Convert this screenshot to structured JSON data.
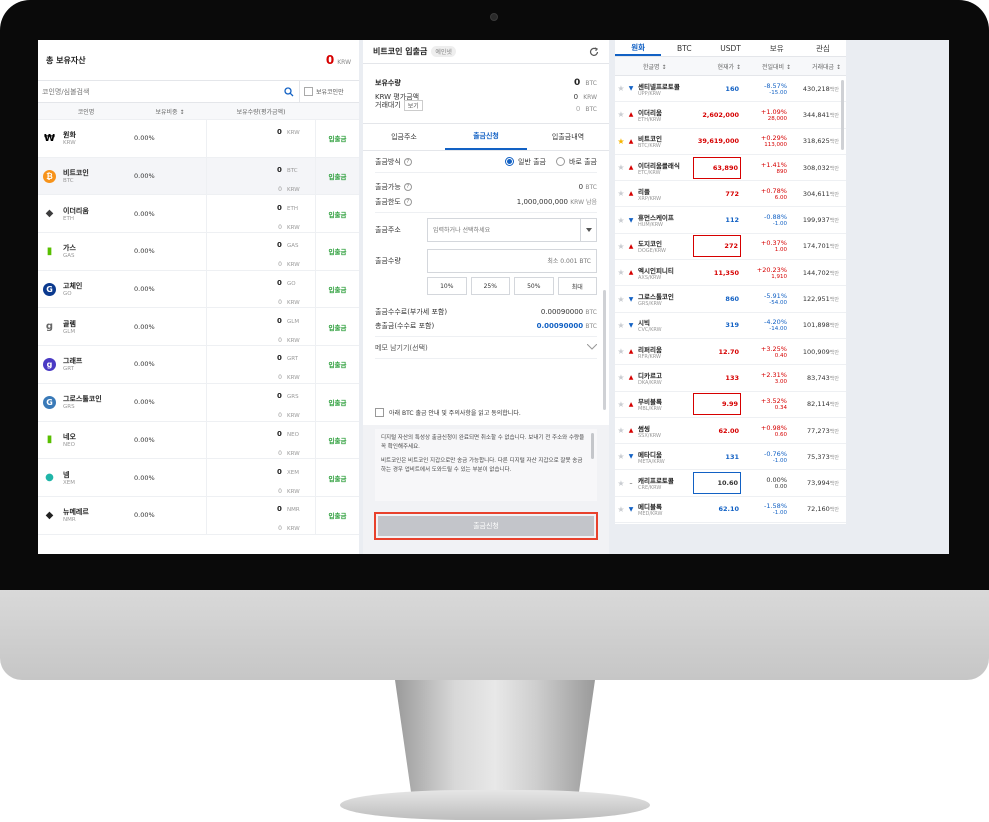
{
  "left": {
    "title": "총 보유자산",
    "total_value": "0",
    "total_unit": "KRW",
    "search_placeholder": "코인명/심볼검색",
    "owned_only_label": "보유코인만",
    "columns": [
      "코인명",
      "보유비중 ↕",
      "보유수량(평가금액)"
    ],
    "coins": [
      {
        "name": "원화",
        "symbol": "KRW",
        "ratio": "0.00%",
        "amount": "0",
        "amount_unit": "KRW",
        "krw": "",
        "krw_unit": "",
        "action": "입출금",
        "icon": "won-sign-icon",
        "icon_color": "#000000"
      },
      {
        "name": "비트코인",
        "symbol": "BTC",
        "ratio": "0.00%",
        "amount": "0",
        "amount_unit": "BTC",
        "krw": "0",
        "krw_unit": "KRW",
        "action": "입출금",
        "icon": "bitcoin-icon",
        "icon_color": "#f7931a"
      },
      {
        "name": "이더리움",
        "symbol": "ETH",
        "ratio": "0.00%",
        "amount": "0",
        "amount_unit": "ETH",
        "krw": "0",
        "krw_unit": "KRW",
        "action": "입출금",
        "icon": "ethereum-icon",
        "icon_color": "#3c3c3d"
      },
      {
        "name": "가스",
        "symbol": "GAS",
        "ratio": "0.00%",
        "amount": "0",
        "amount_unit": "GAS",
        "krw": "0",
        "krw_unit": "KRW",
        "action": "입출금",
        "icon": "gas-icon",
        "icon_color": "#58bf00"
      },
      {
        "name": "고체인",
        "symbol": "GO",
        "ratio": "0.00%",
        "amount": "0",
        "amount_unit": "GO",
        "krw": "0",
        "krw_unit": "KRW",
        "action": "입출금",
        "icon": "gochain-icon",
        "icon_color": "#0b3a8f"
      },
      {
        "name": "골렘",
        "symbol": "GLM",
        "ratio": "0.00%",
        "amount": "0",
        "amount_unit": "GLM",
        "krw": "0",
        "krw_unit": "KRW",
        "action": "입출금",
        "icon": "golem-icon",
        "icon_color": "#666666"
      },
      {
        "name": "그래프",
        "symbol": "GRT",
        "ratio": "0.00%",
        "amount": "0",
        "amount_unit": "GRT",
        "krw": "0",
        "krw_unit": "KRW",
        "action": "입출금",
        "icon": "graph-icon",
        "icon_color": "#4a3ac4"
      },
      {
        "name": "그로스톨코인",
        "symbol": "GRS",
        "ratio": "0.00%",
        "amount": "0",
        "amount_unit": "GRS",
        "krw": "0",
        "krw_unit": "KRW",
        "action": "입출금",
        "icon": "groestlcoin-icon",
        "icon_color": "#3a7ab8"
      },
      {
        "name": "네오",
        "symbol": "NEO",
        "ratio": "0.00%",
        "amount": "0",
        "amount_unit": "NEO",
        "krw": "0",
        "krw_unit": "KRW",
        "action": "입출금",
        "icon": "neo-icon",
        "icon_color": "#58bf00"
      },
      {
        "name": "넴",
        "symbol": "XEM",
        "ratio": "0.00%",
        "amount": "0",
        "amount_unit": "XEM",
        "krw": "0",
        "krw_unit": "KRW",
        "action": "입출금",
        "icon": "nem-icon",
        "icon_color": "#20b5a8"
      },
      {
        "name": "뉴메레르",
        "symbol": "NMR",
        "ratio": "0.00%",
        "amount": "0",
        "amount_unit": "NMR",
        "krw": "0",
        "krw_unit": "KRW",
        "action": "입출금",
        "icon": "numeraire-icon",
        "icon_color": "#222222"
      }
    ]
  },
  "mid": {
    "title": "비트코인 입출금",
    "badge": "예인넷",
    "holdings_label": "보유수량",
    "holdings_value": "0",
    "holdings_unit": "BTC",
    "krw_eval_label": "KRW 평가금액",
    "krw_eval_value": "0",
    "krw_eval_unit": "KRW",
    "pending_label": "거래대기",
    "pending_btn": "보기",
    "pending_value": "0",
    "pending_unit": "BTC",
    "tabs": [
      "입금주소",
      "출금신청",
      "입출금내역"
    ],
    "method_label": "출금방식",
    "method_normal": "일반 출금",
    "method_fast": "바로 출금",
    "available_label": "출금가능",
    "available_value": "0",
    "available_unit": "BTC",
    "limit_label": "출금한도",
    "limit_value": "1,000,000,000",
    "limit_unit": "KRW 남음",
    "address_label": "출금주소",
    "address_placeholder": "입력하거나 선택하세요",
    "qty_label": "출금수량",
    "qty_placeholder": "최소 0.001 BTC",
    "pct_buttons": [
      "10%",
      "25%",
      "50%",
      "최대"
    ],
    "fee_label": "출금수수료(부가세 포함)",
    "fee_value": "0.00090000",
    "fee_unit": "BTC",
    "total_label": "총출금(수수료 포함)",
    "total_value": "0.00090000",
    "total_unit": "BTC",
    "memo_label": "메모 남기기(선택)",
    "agree_label": "아래 BTC 출금 안내 및 주의사항을 읽고 동의합니다.",
    "notice1": "디지털 자산의 특성상 출금신청이 완료되면 취소할 수 없습니다. 보내기 전 주소와 수량을 꼭 확인해주세요.",
    "notice2": "비트코인은 비트코인 지갑으로만 송금 가능합니다. 다른 디지털 자산 지갑으로 잘못 송금하는 경우 업비트에서 도와드릴 수 있는 부분이 없습니다.",
    "submit": "출금신청",
    "accent": "#1261c4",
    "highlight": "#e8412c"
  },
  "right": {
    "tabs": [
      "원화",
      "BTC",
      "USDT",
      "보유",
      "관심"
    ],
    "columns": [
      "한글명 ↕",
      "현재가 ↕",
      "전일대비 ↕",
      "거래대금 ↕"
    ],
    "rows": [
      {
        "name": "센티넬프로토콜",
        "pair": "UPP/KRW",
        "price": "160",
        "pct": "-8.57%",
        "diff": "-15.00",
        "volume": "430,218",
        "vol_unit": "백만",
        "dir": "down",
        "star": false,
        "boxed": false
      },
      {
        "name": "이더리움",
        "pair": "ETH/KRW",
        "price": "2,602,000",
        "pct": "+1.09%",
        "diff": "28,000",
        "volume": "344,841",
        "vol_unit": "백만",
        "dir": "up",
        "star": false,
        "boxed": false
      },
      {
        "name": "비트코인",
        "pair": "BTC/KRW",
        "price": "39,619,000",
        "pct": "+0.29%",
        "diff": "113,000",
        "volume": "318,625",
        "vol_unit": "백만",
        "dir": "up",
        "star": true,
        "boxed": false
      },
      {
        "name": "이더리움클래식",
        "pair": "ETC/KRW",
        "price": "63,890",
        "pct": "+1.41%",
        "diff": "890",
        "volume": "308,032",
        "vol_unit": "백만",
        "dir": "up",
        "star": false,
        "boxed": true
      },
      {
        "name": "리플",
        "pair": "XRP/KRW",
        "price": "772",
        "pct": "+0.78%",
        "diff": "6.00",
        "volume": "304,611",
        "vol_unit": "백만",
        "dir": "up",
        "star": false,
        "boxed": false
      },
      {
        "name": "휴먼스케이프",
        "pair": "HUM/KRW",
        "price": "112",
        "pct": "-0.88%",
        "diff": "-1.00",
        "volume": "199,937",
        "vol_unit": "백만",
        "dir": "down",
        "star": false,
        "boxed": false
      },
      {
        "name": "도지코인",
        "pair": "DOGE/KRW",
        "price": "272",
        "pct": "+0.37%",
        "diff": "1.00",
        "volume": "174,701",
        "vol_unit": "백만",
        "dir": "up",
        "star": false,
        "boxed": true
      },
      {
        "name": "엑시인피니티",
        "pair": "AXS/KRW",
        "price": "11,350",
        "pct": "+20.23%",
        "diff": "1,910",
        "volume": "144,702",
        "vol_unit": "백만",
        "dir": "up",
        "star": false,
        "boxed": false
      },
      {
        "name": "그로스톨코인",
        "pair": "GRS/KRW",
        "price": "860",
        "pct": "-5.91%",
        "diff": "-54.00",
        "volume": "122,951",
        "vol_unit": "백만",
        "dir": "down",
        "star": false,
        "boxed": false
      },
      {
        "name": "시빅",
        "pair": "CVC/KRW",
        "price": "319",
        "pct": "-4.20%",
        "diff": "-14.00",
        "volume": "101,898",
        "vol_unit": "백만",
        "dir": "down",
        "star": false,
        "boxed": false
      },
      {
        "name": "리퍼리움",
        "pair": "RFR/KRW",
        "price": "12.70",
        "pct": "+3.25%",
        "diff": "0.40",
        "volume": "100,909",
        "vol_unit": "백만",
        "dir": "up",
        "star": false,
        "boxed": false
      },
      {
        "name": "디카르고",
        "pair": "DKA/KRW",
        "price": "133",
        "pct": "+2.31%",
        "diff": "3.00",
        "volume": "83,743",
        "vol_unit": "백만",
        "dir": "up",
        "star": false,
        "boxed": false
      },
      {
        "name": "무비블록",
        "pair": "MBL/KRW",
        "price": "9.99",
        "pct": "+3.52%",
        "diff": "0.34",
        "volume": "82,114",
        "vol_unit": "백만",
        "dir": "up",
        "star": false,
        "boxed": true
      },
      {
        "name": "썸씽",
        "pair": "SSX/KRW",
        "price": "62.00",
        "pct": "+0.98%",
        "diff": "0.60",
        "volume": "77,273",
        "vol_unit": "백만",
        "dir": "up",
        "star": false,
        "boxed": false
      },
      {
        "name": "메타디움",
        "pair": "META/KRW",
        "price": "131",
        "pct": "-0.76%",
        "diff": "-1.00",
        "volume": "75,373",
        "vol_unit": "백만",
        "dir": "down",
        "star": false,
        "boxed": false
      },
      {
        "name": "캐리프로토콜",
        "pair": "CRE/KRW",
        "price": "10.60",
        "pct": "0.00%",
        "diff": "0.00",
        "volume": "73,994",
        "vol_unit": "백만",
        "dir": "flat",
        "star": false,
        "boxed": true
      },
      {
        "name": "메디블록",
        "pair": "MED/KRW",
        "price": "62.10",
        "pct": "-1.58%",
        "diff": "-1.00",
        "volume": "72,160",
        "vol_unit": "백만",
        "dir": "down",
        "star": false,
        "boxed": false
      }
    ]
  }
}
